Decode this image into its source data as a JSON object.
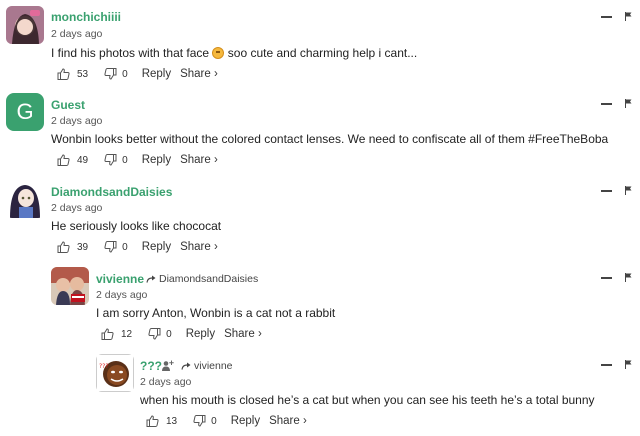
{
  "comments": [
    {
      "author": "monchichiiii",
      "date": "2 days ago",
      "text_before": "I find his photos with that face",
      "text_after": "soo cute and charming help i cant...",
      "likes": "53",
      "dislikes": "0",
      "reply_label": "Reply",
      "share_label": "Share ›"
    },
    {
      "author": "Guest",
      "avatar_letter": "G",
      "date": "2 days ago",
      "text": "Wonbin looks better without the colored contact lenses. We need to confiscate all of them #FreeTheBoba",
      "likes": "49",
      "dislikes": "0",
      "reply_label": "Reply",
      "share_label": "Share ›"
    },
    {
      "author": "DiamondsandDaisies",
      "date": "2 days ago",
      "text": "He seriously looks like chococat",
      "likes": "39",
      "dislikes": "0",
      "reply_label": "Reply",
      "share_label": "Share ›"
    },
    {
      "author": "vivienne",
      "reply_to": "DiamondsandDaisies",
      "date": "2 days ago",
      "text": "I am sorry Anton, Wonbin is a cat not a rabbit",
      "likes": "12",
      "dislikes": "0",
      "reply_label": "Reply",
      "share_label": "Share ›"
    },
    {
      "author": "???",
      "reply_to": "vivienne",
      "date": "2 days ago",
      "text": "when his mouth is closed he’s a cat but when you can see his teeth he’s a total bunny",
      "likes": "13",
      "dislikes": "0",
      "reply_label": "Reply",
      "share_label": "Share ›"
    }
  ],
  "colors": {
    "author_name": "#3aa16f",
    "guest_avatar_bg": "#3aa16f",
    "text": "#222222",
    "meta": "#555555"
  },
  "icons": {
    "like": "thumbs-up-icon",
    "dislike": "thumbs-down-icon",
    "minimize": "minimize-icon",
    "flag": "flag-icon",
    "reply_arrow": "reply-arrow-icon",
    "follow": "add-user-icon"
  }
}
